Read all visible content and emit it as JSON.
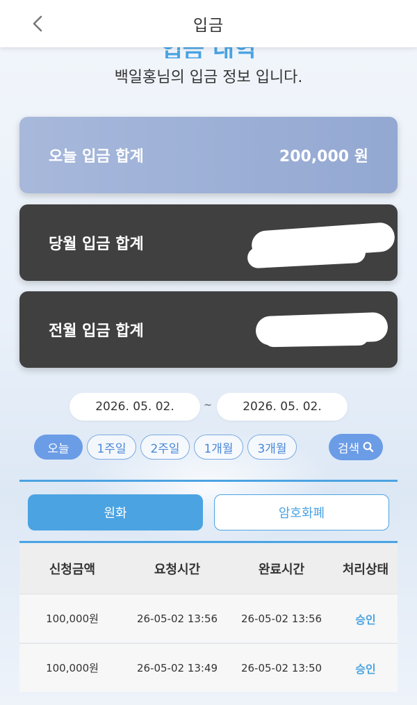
{
  "header": {
    "title": "입금",
    "back_icon": "chevron-left-icon"
  },
  "page_heading": "입금 내역",
  "subtitle": "백일홍님의 입금 정보 입니다.",
  "summary_cards": {
    "today": {
      "label": "오늘 입금 합계",
      "value": "200,000 원"
    },
    "month": {
      "label": "당월 입금 합계"
    },
    "previous_month": {
      "label": "전월 입금 합계"
    }
  },
  "date_range": {
    "start": "2026. 05. 02.",
    "separator": "~",
    "end": "2026. 05. 02."
  },
  "period_filters": [
    "오늘",
    "1주일",
    "2주일",
    "1개월",
    "3개월"
  ],
  "search_button": {
    "label": "검색",
    "icon": "search-icon"
  },
  "tabs": [
    "원화",
    "암호화폐"
  ],
  "table": {
    "headers": [
      "신청금액",
      "요청시간",
      "완료시간",
      "처리상태"
    ],
    "rows": [
      [
        "100,000원",
        "26-05-02 13:56",
        "26-05-02 13:56",
        "승인"
      ],
      [
        "100,000원",
        "26-05-02 13:49",
        "26-05-02 13:50",
        "승인"
      ]
    ]
  },
  "colors": {
    "accent": "#4ba3e2",
    "button_blue": "#6b9ce6",
    "dark_card": "#404040",
    "today_card": "#a7b8db"
  }
}
